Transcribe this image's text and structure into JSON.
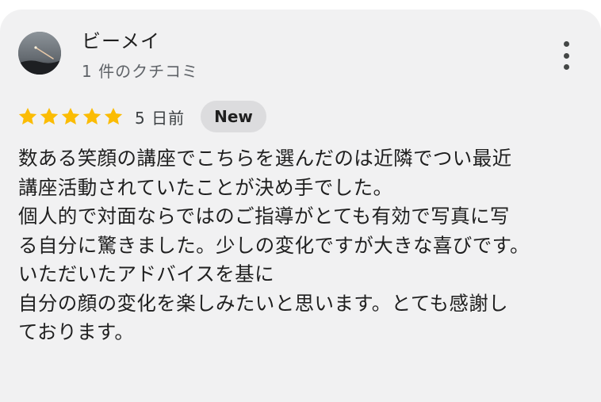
{
  "review": {
    "reviewer_name": "ビーメイ",
    "review_count": "1 件のクチコミ",
    "rating": 5,
    "rating_max": 5,
    "date": "5 日前",
    "badge": "New",
    "star_color": "#fbbc04",
    "text": "数ある笑顔の講座でこちらを選んだのは近隣でつい最近\n講座活動されていたことが決め手でした。\n個人的で対面ならではのご指導がとても有効で写真に写\nる自分に驚きました。少しの変化ですが大きな喜びです。\nいただいたアドバイスを基に\n自分の顔の変化を楽しみたいと思います。とても感謝し\nております。"
  },
  "icons": {
    "more": "more-vert-icon",
    "star": "star-icon",
    "avatar": "avatar-image"
  },
  "colors": {
    "card_background": "#f1f1f2",
    "badge_background": "#dcdcde",
    "text_primary": "#1f1f1f",
    "text_secondary": "#5f6368"
  }
}
